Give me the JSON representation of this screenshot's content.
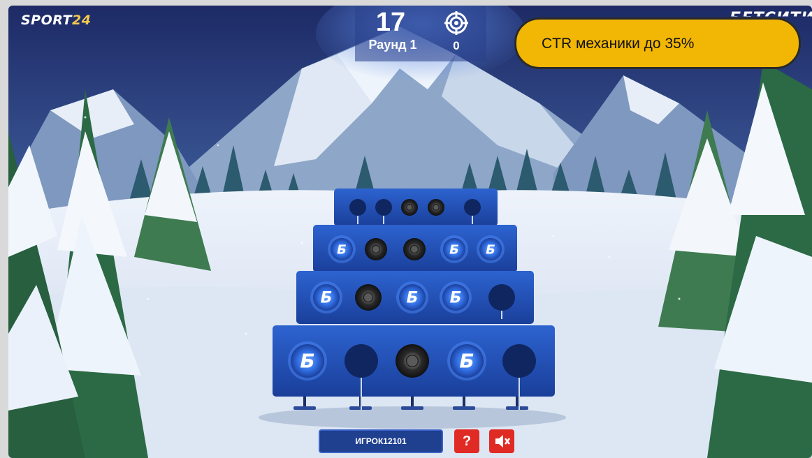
{
  "brand": {
    "left_logo_main": "SPORT",
    "left_logo_accent": "24",
    "right_logo": "БЕТСИТИ"
  },
  "hud": {
    "timer": "17",
    "round": "Раунд 1",
    "hits": "0",
    "target_icon": "crosshair-target-icon"
  },
  "banner": {
    "text": "CTR механики до 35%"
  },
  "footer": {
    "player_name": "ИГРОК12101",
    "help_label": "?",
    "sound_icon": "speaker-muted-icon"
  },
  "targets": {
    "rows": [
      [
        "hole",
        "hole",
        "target",
        "target",
        "hole"
      ],
      [
        "hit",
        "target",
        "target",
        "hit",
        "hit"
      ],
      [
        "hit",
        "target",
        "hit",
        "hit",
        "hole"
      ],
      [
        "hit",
        "hole",
        "target",
        "hit",
        "hole"
      ]
    ],
    "hit_glyph": "Б"
  },
  "colors": {
    "panel": "#1f4fb8",
    "accent_yellow": "#f2b705",
    "button_red": "#e02a24"
  }
}
